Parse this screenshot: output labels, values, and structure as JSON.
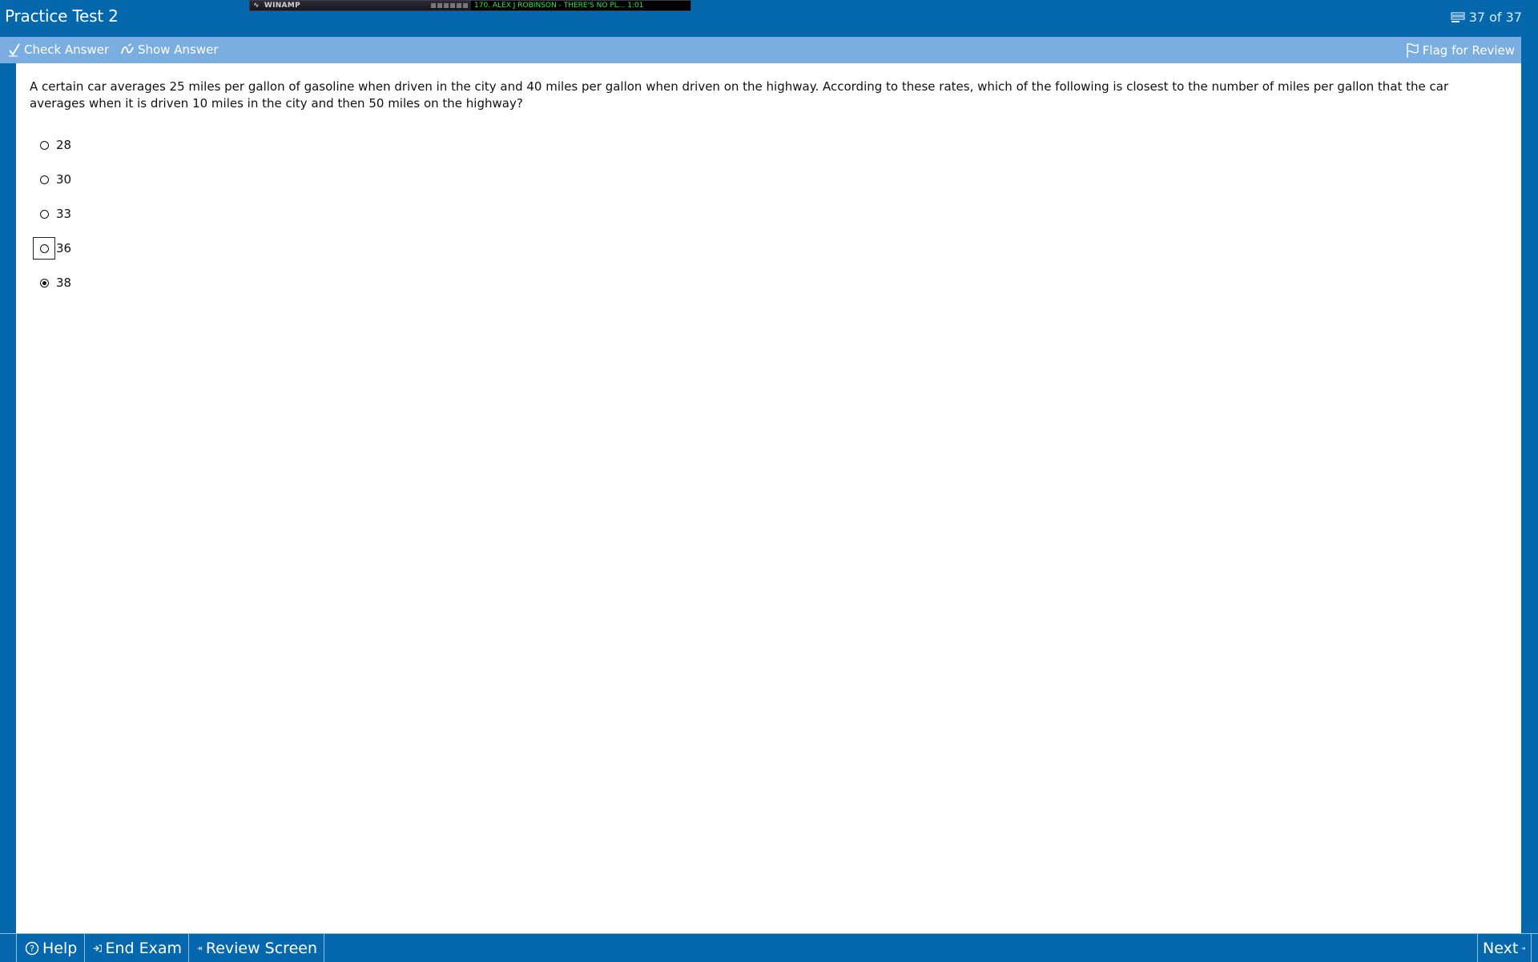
{
  "window": {
    "title": "Practice Test 2",
    "counter": "37 of 37",
    "counter_icon": "question-list-icon"
  },
  "winamp": {
    "app_name": "WINAMP",
    "track": "170. ALEX J ROBINSON - THERE'S NO PL...  1:01"
  },
  "toolbar": {
    "check_answer": "Check Answer",
    "show_answer": "Show Answer",
    "flag_for_review": "Flag for Review"
  },
  "question": {
    "text": "A certain car averages 25 miles per gallon of gasoline when driven in the city and 40 miles per gallon when driven on the highway.  According to these rates, which of the following is closest to the number of miles per gallon that the car averages when it is driven 10 miles in the city and then 50 miles on the highway?",
    "options": [
      {
        "label": "28",
        "selected": false,
        "focused": false
      },
      {
        "label": "30",
        "selected": false,
        "focused": false
      },
      {
        "label": "33",
        "selected": false,
        "focused": false
      },
      {
        "label": "36",
        "selected": false,
        "focused": true
      },
      {
        "label": "38",
        "selected": true,
        "focused": false
      }
    ]
  },
  "bottom_bar": {
    "help": "Help",
    "end_exam": "End Exam",
    "review_screen": "Review Screen",
    "next": "Next"
  },
  "colors": {
    "frame_blue": "#0568ac",
    "toolbar_blue": "#7aaee0",
    "content_bg": "#ffffff",
    "winamp_text": "#2ee640"
  }
}
